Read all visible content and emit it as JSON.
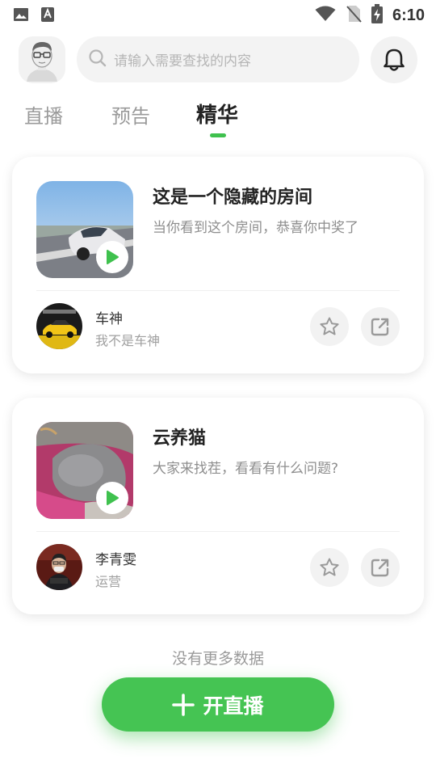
{
  "status_bar": {
    "time": "6:10",
    "left_icons": [
      "image-icon",
      "text-a-icon"
    ],
    "right_icons": [
      "wifi-icon",
      "no-sim-icon",
      "battery-charging-icon"
    ]
  },
  "header": {
    "search_placeholder": "请输入需要查找的内容"
  },
  "tabs": [
    {
      "label": "直播",
      "active": false
    },
    {
      "label": "预告",
      "active": false
    },
    {
      "label": "精华",
      "active": true
    }
  ],
  "cards": [
    {
      "title": "这是一个隐藏的房间",
      "description": "当你看到这个房间，恭喜你中奖了",
      "user_name": "车神",
      "user_subtitle": "我不是车神"
    },
    {
      "title": "云养猫",
      "description": "大家来找茬，看看有什么问题?",
      "user_name": "李青雯",
      "user_subtitle": "运营"
    }
  ],
  "footer": {
    "no_more": "没有更多数据",
    "live_button_label": "开直播"
  },
  "colors": {
    "accent": "#45c453",
    "tab_indicator": "#3fc14e"
  }
}
